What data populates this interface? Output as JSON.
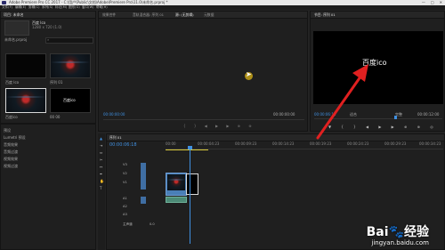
{
  "window": {
    "title": "Adobe Premiere Pro CC 2017 - C:\\用户\\Public\\文档\\Adobe\\Premiere Pro\\11.0\\未命名.prproj *",
    "controls": [
      "—",
      "□",
      "✕"
    ]
  },
  "menu": [
    "文件(F)",
    "编辑(E)",
    "剪辑(C)",
    "序列(S)",
    "标记(M)",
    "图形(G)",
    "窗口(W)",
    "帮助(H)"
  ],
  "project": {
    "tab": "项目: 未命名",
    "file_name": "未命名.prproj",
    "item_name": "百度 Ico",
    "item_info": "1280 x 720 (1.0)",
    "thumb_label_1": "百度 Ico",
    "thumb_label_2": "序列 01",
    "thumb_label_3": "百度ico",
    "thumb_label_4": "00 00",
    "thumb_text": "百度ico"
  },
  "source": {
    "tabs": [
      "效果控件",
      "音轨混合器: 序列 01",
      "源: (无剪辑)",
      "元数据"
    ],
    "active_tab_index": 2,
    "timecode_left": "00:00:00:00",
    "timecode_right": "00:00:00:00"
  },
  "program": {
    "tab": "节目: 序列 01",
    "overlay_text": "百度ico",
    "timecode_left": "00:00:06:18",
    "timecode_right": "00:00:12:00",
    "zoom": "适合",
    "resolution": "完整"
  },
  "effects": {
    "items": [
      "预设",
      "Lumetri 预设",
      "音频效果",
      "音频过渡",
      "视频效果",
      "视频过渡"
    ]
  },
  "timeline": {
    "tab": "序列 01",
    "timecode": "00:00:06:18",
    "ruler": [
      "00:00",
      "00:00:04:23",
      "00:00:09:23",
      "00:00:14:23",
      "00:00:19:23",
      "00:00:24:23",
      "00:00:29:23",
      "00:00:34:23"
    ],
    "tracks": [
      "V3",
      "V2",
      "V1",
      "A1",
      "A2",
      "A3"
    ],
    "master": "主声道",
    "master_value": "0.0"
  },
  "colors": {
    "accent_blue": "#3f8fe0",
    "playhead": "#3f8fe0",
    "arrow": "#e02020"
  },
  "icons": [
    "selection-tool-icon",
    "ripple-edit-icon",
    "razor-icon",
    "slip-icon",
    "pen-icon",
    "hand-icon",
    "type-icon",
    "play-icon",
    "wrench-icon"
  ],
  "watermark": {
    "brand": "Bai",
    "brand_cn": "经验",
    "url": "jingyan.baidu.com"
  }
}
